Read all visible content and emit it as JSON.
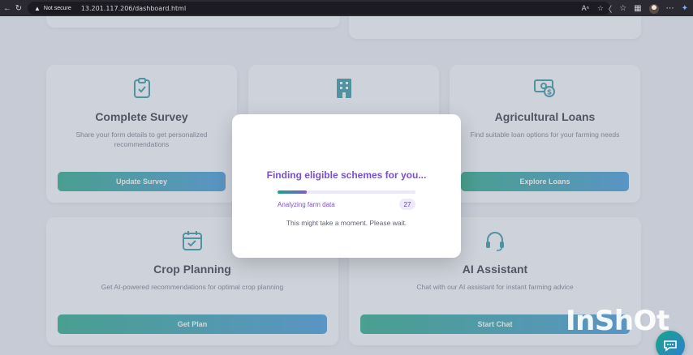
{
  "browser": {
    "security_label": "Not secure",
    "url": "13.201.117.206/dashboard.html"
  },
  "cards": [
    {
      "id": "survey",
      "icon": "clipboard-check-icon",
      "title": "Complete Survey",
      "desc": "Share your form details to get personalized recommendations",
      "button": "Update Survey"
    },
    {
      "id": "schemes",
      "icon": "building-icon",
      "title": "",
      "desc": "",
      "button": ""
    },
    {
      "id": "loans",
      "icon": "money-bill-icon",
      "title": "Agricultural Loans",
      "desc": "Find suitable loan options for your farming needs",
      "button": "Explore Loans"
    },
    {
      "id": "crop",
      "icon": "calendar-check-icon",
      "title": "Crop Planning",
      "desc": "Get AI-powered recommendations for optimal crop planning",
      "button": "Get Plan"
    },
    {
      "id": "assistant",
      "icon": "headset-icon",
      "title": "AI Assistant",
      "desc": "Chat with our AI assistant for instant farming advice",
      "button": "Start Chat"
    }
  ],
  "modal": {
    "title": "Finding eligible schemes for you...",
    "step_label": "Analyzing farm data",
    "progress_value": 27,
    "progress_fraction": 0.21,
    "note": "This might take a moment. Please wait."
  },
  "watermark": "InShOt",
  "colors": {
    "accent_purple": "#7b4fd1",
    "button_start": "#12a07c",
    "button_end": "#2f8fd6"
  }
}
